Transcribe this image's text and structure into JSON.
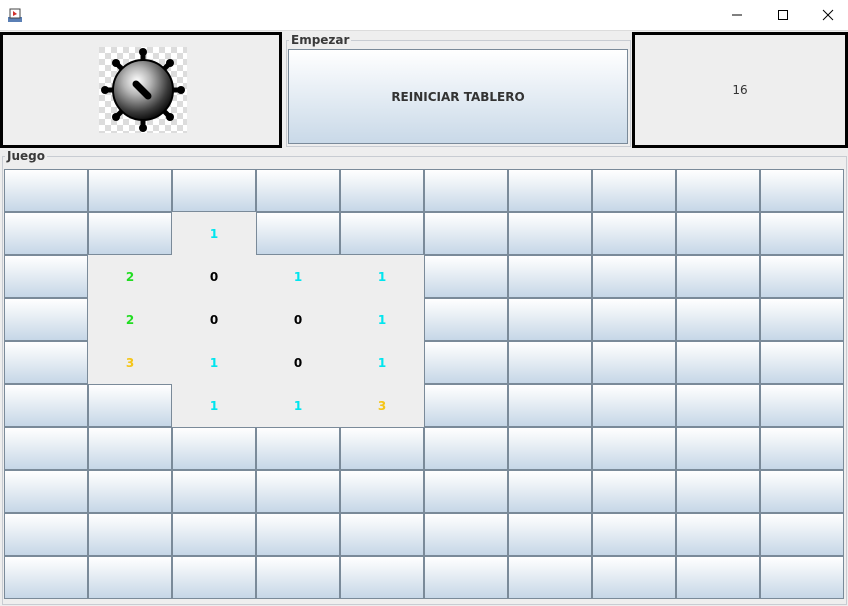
{
  "window": {
    "controls": {
      "minimize": "minimize-icon",
      "maximize": "maximize-icon",
      "close": "close-icon"
    }
  },
  "start_panel": {
    "legend": "Empezar",
    "reset_label": "REINICIAR TABLERO"
  },
  "counter": {
    "value": "16"
  },
  "game": {
    "legend": "Juego"
  },
  "board": {
    "rows": 10,
    "cols": 10,
    "revealed": [
      {
        "r": 1,
        "c": 2,
        "v": "1"
      },
      {
        "r": 2,
        "c": 1,
        "v": "2"
      },
      {
        "r": 2,
        "c": 2,
        "v": "0"
      },
      {
        "r": 2,
        "c": 3,
        "v": "1"
      },
      {
        "r": 2,
        "c": 4,
        "v": "1"
      },
      {
        "r": 3,
        "c": 1,
        "v": "2"
      },
      {
        "r": 3,
        "c": 2,
        "v": "0"
      },
      {
        "r": 3,
        "c": 3,
        "v": "0"
      },
      {
        "r": 3,
        "c": 4,
        "v": "1"
      },
      {
        "r": 4,
        "c": 1,
        "v": "3"
      },
      {
        "r": 4,
        "c": 2,
        "v": "1"
      },
      {
        "r": 4,
        "c": 3,
        "v": "0"
      },
      {
        "r": 4,
        "c": 4,
        "v": "1"
      },
      {
        "r": 5,
        "c": 2,
        "v": "1"
      },
      {
        "r": 5,
        "c": 3,
        "v": "1"
      },
      {
        "r": 5,
        "c": 4,
        "v": "3"
      }
    ],
    "number_colors": {
      "0": "#000000",
      "1": "#00e5ee",
      "2": "#22dd22",
      "3": "#f5c518"
    }
  }
}
